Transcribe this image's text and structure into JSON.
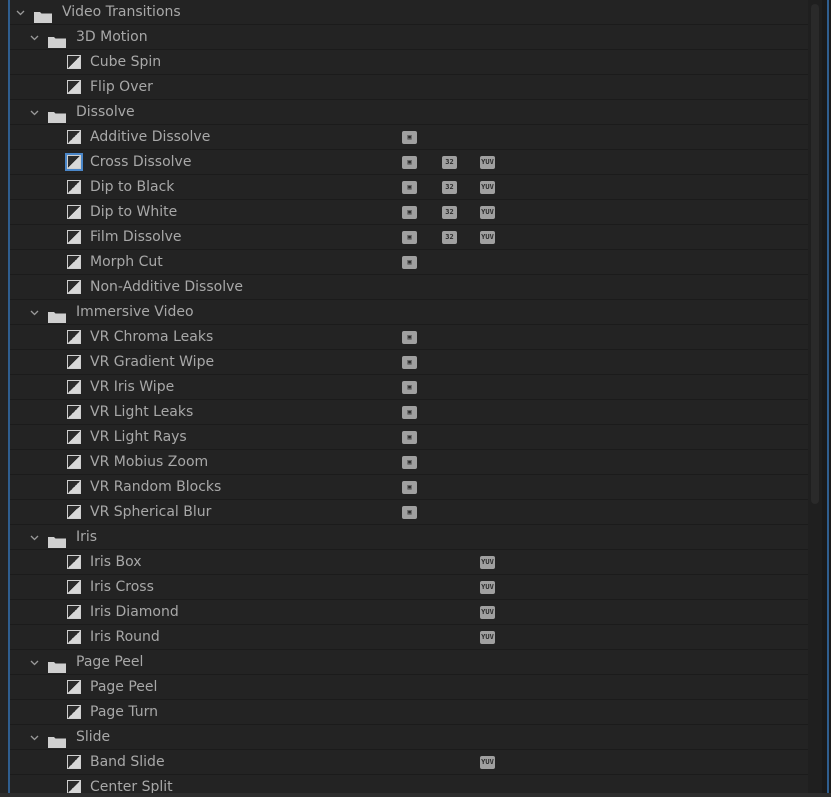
{
  "tree": {
    "root": {
      "label": "Video Transitions"
    },
    "groups": [
      {
        "label": "3D Motion",
        "items": [
          {
            "label": "Cube Spin",
            "badges": []
          },
          {
            "label": "Flip Over",
            "badges": []
          }
        ]
      },
      {
        "label": "Dissolve",
        "items": [
          {
            "label": "Additive Dissolve",
            "badges": [
              "accel"
            ]
          },
          {
            "label": "Cross Dissolve",
            "badges": [
              "accel",
              "32",
              "yuv"
            ],
            "selected": true
          },
          {
            "label": "Dip to Black",
            "badges": [
              "accel",
              "32",
              "yuv"
            ]
          },
          {
            "label": "Dip to White",
            "badges": [
              "accel",
              "32",
              "yuv"
            ]
          },
          {
            "label": "Film Dissolve",
            "badges": [
              "accel",
              "32",
              "yuv"
            ]
          },
          {
            "label": "Morph Cut",
            "badges": [
              "accel"
            ]
          },
          {
            "label": "Non-Additive Dissolve",
            "badges": []
          }
        ]
      },
      {
        "label": "Immersive Video",
        "items": [
          {
            "label": "VR Chroma Leaks",
            "badges": [
              "accel"
            ]
          },
          {
            "label": "VR Gradient Wipe",
            "badges": [
              "accel"
            ]
          },
          {
            "label": "VR Iris Wipe",
            "badges": [
              "accel"
            ]
          },
          {
            "label": "VR Light Leaks",
            "badges": [
              "accel"
            ]
          },
          {
            "label": "VR Light Rays",
            "badges": [
              "accel"
            ]
          },
          {
            "label": "VR Mobius Zoom",
            "badges": [
              "accel"
            ]
          },
          {
            "label": "VR Random Blocks",
            "badges": [
              "accel"
            ]
          },
          {
            "label": "VR Spherical Blur",
            "badges": [
              "accel"
            ]
          }
        ]
      },
      {
        "label": "Iris",
        "items": [
          {
            "label": "Iris Box",
            "badges": [
              "yuv"
            ]
          },
          {
            "label": "Iris Cross",
            "badges": [
              "yuv"
            ]
          },
          {
            "label": "Iris Diamond",
            "badges": [
              "yuv"
            ]
          },
          {
            "label": "Iris Round",
            "badges": [
              "yuv"
            ]
          }
        ]
      },
      {
        "label": "Page Peel",
        "items": [
          {
            "label": "Page Peel",
            "badges": []
          },
          {
            "label": "Page Turn",
            "badges": []
          }
        ]
      },
      {
        "label": "Slide",
        "items": [
          {
            "label": "Band Slide",
            "badges": [
              "yuv"
            ]
          },
          {
            "label": "Center Split",
            "badges": []
          }
        ]
      }
    ]
  },
  "badge_text": {
    "accel": "▣",
    "32": "32",
    "yuv": "YUV"
  },
  "icons": {
    "chevron": "chevron-down-icon",
    "folder": "folder-icon",
    "transition": "transition-icon",
    "accel": "gpu-accelerated-icon",
    "32": "32-bit-icon",
    "yuv": "yuv-icon"
  },
  "colors": {
    "background": "#232323",
    "text": "#a8a8a8",
    "accent": "#4a86c8",
    "badge": "#a0a0a0"
  }
}
